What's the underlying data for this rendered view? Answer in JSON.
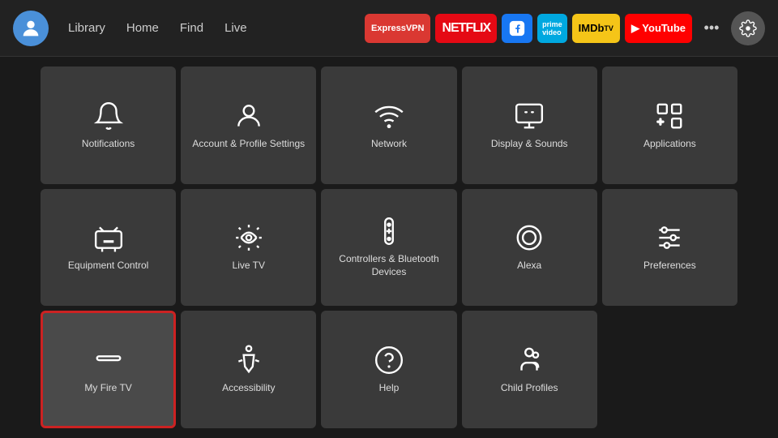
{
  "nav": {
    "links": [
      "Library",
      "Home",
      "Find",
      "Live"
    ],
    "apps": [
      {
        "id": "expressvpn",
        "label": "ExpressVPN",
        "class": "app-expressvpn"
      },
      {
        "id": "netflix",
        "label": "NETFLIX",
        "class": "app-netflix"
      },
      {
        "id": "fbwatch",
        "label": "▶",
        "class": "app-fbwatch"
      },
      {
        "id": "prime",
        "label": "prime video",
        "class": "app-prime"
      },
      {
        "id": "imdb",
        "label": "IMDbTV",
        "class": "app-imdb"
      },
      {
        "id": "youtube",
        "label": "▶YouTube",
        "class": "app-youtube"
      }
    ],
    "more_label": "•••",
    "settings_label": "⚙"
  },
  "tiles": [
    {
      "id": "notifications",
      "label": "Notifications",
      "icon": "bell",
      "selected": false
    },
    {
      "id": "account-profile",
      "label": "Account & Profile Settings",
      "icon": "person",
      "selected": false
    },
    {
      "id": "network",
      "label": "Network",
      "icon": "wifi",
      "selected": false
    },
    {
      "id": "display-sounds",
      "label": "Display & Sounds",
      "icon": "display",
      "selected": false
    },
    {
      "id": "applications",
      "label": "Applications",
      "icon": "apps",
      "selected": false
    },
    {
      "id": "equipment-control",
      "label": "Equipment Control",
      "icon": "tv",
      "selected": false
    },
    {
      "id": "live-tv",
      "label": "Live TV",
      "icon": "livetv",
      "selected": false
    },
    {
      "id": "controllers-bluetooth",
      "label": "Controllers & Bluetooth Devices",
      "icon": "remote",
      "selected": false
    },
    {
      "id": "alexa",
      "label": "Alexa",
      "icon": "alexa",
      "selected": false
    },
    {
      "id": "preferences",
      "label": "Preferences",
      "icon": "sliders",
      "selected": false
    },
    {
      "id": "my-fire-tv",
      "label": "My Fire TV",
      "icon": "firetv",
      "selected": true
    },
    {
      "id": "accessibility",
      "label": "Accessibility",
      "icon": "accessibility",
      "selected": false
    },
    {
      "id": "help",
      "label": "Help",
      "icon": "help",
      "selected": false
    },
    {
      "id": "child-profiles",
      "label": "Child Profiles",
      "icon": "child",
      "selected": false
    }
  ]
}
